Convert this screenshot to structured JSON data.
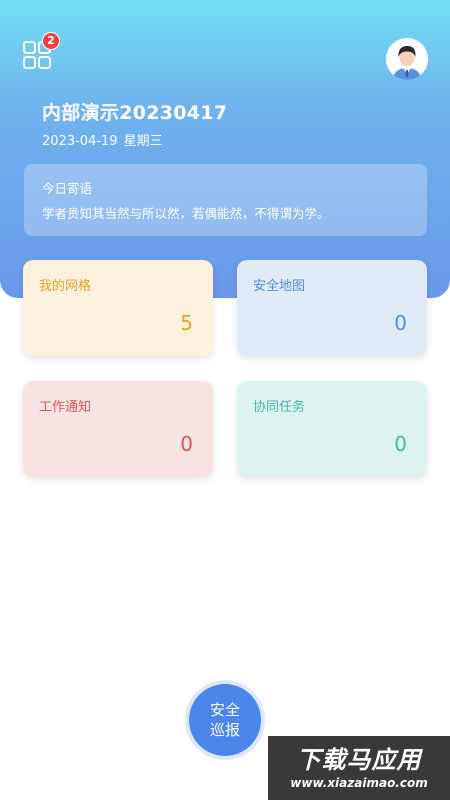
{
  "colors": {
    "header_gradient_top": "#74def2",
    "header_gradient_bottom": "#6b97ea",
    "badge": "#e8433f",
    "patrol_button": "#4a86ea"
  },
  "header": {
    "apps_icon": "grid-apps-icon",
    "notification_count": "2",
    "avatar_icon": "user-avatar-icon",
    "title": "内部演示20230417",
    "date": "2023-04-19",
    "weekday": "星期三"
  },
  "quote": {
    "title": "今日寄语",
    "text": "学者贵知其当然与所以然，若偶能然，不得谓为学。"
  },
  "tiles": [
    {
      "label": "我的网格",
      "value": "5",
      "color": "#e3a22a"
    },
    {
      "label": "安全地图",
      "value": "0",
      "color": "#4f8fd6"
    },
    {
      "label": "工作通知",
      "value": "0",
      "color": "#d9555b"
    },
    {
      "label": "协同任务",
      "value": "0",
      "color": "#45b6a8"
    }
  ],
  "patrol": {
    "line1": "安全",
    "line2": "巡报"
  },
  "watermark": {
    "title": "下载马应用",
    "url": "www.xiazaimao.com"
  }
}
